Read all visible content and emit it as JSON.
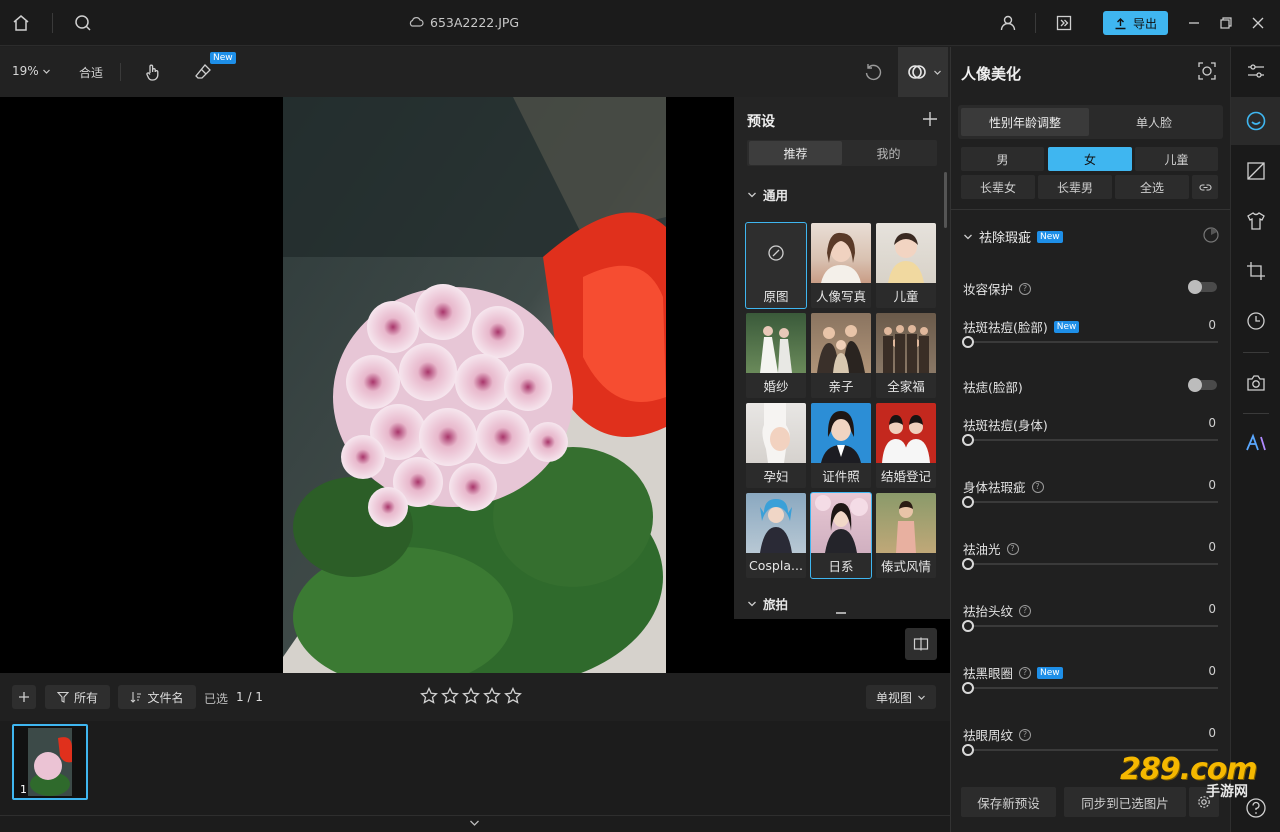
{
  "titlebar": {
    "filename": "653A2222.JPG",
    "export_label": "导出"
  },
  "toolbar": {
    "zoom": "19%",
    "fit_label": "合适",
    "new_badge": "New"
  },
  "preset_panel": {
    "title": "预设",
    "tabs": [
      {
        "label": "推荐",
        "active": true
      },
      {
        "label": "我的",
        "active": false
      }
    ],
    "section_general": "通用",
    "section_travel": "旅拍",
    "tiles": [
      {
        "label": "原图"
      },
      {
        "label": "人像写真"
      },
      {
        "label": "儿童"
      },
      {
        "label": "婚纱"
      },
      {
        "label": "亲子"
      },
      {
        "label": "全家福"
      },
      {
        "label": "孕妇"
      },
      {
        "label": "证件照"
      },
      {
        "label": "结婚登记"
      },
      {
        "label": "Cospla..."
      },
      {
        "label": "日系"
      },
      {
        "label": "傣式风情"
      }
    ]
  },
  "bottombar": {
    "filter_all": "所有",
    "sort_label": "文件名",
    "selected_label": "已选",
    "selected_count": "1 / 1",
    "rating_stars": 5,
    "view_mode": "单视图",
    "thumb_index": "1"
  },
  "right_panel": {
    "title": "人像美化",
    "mode_tabs": [
      {
        "label": "性别年龄调整",
        "active": true
      },
      {
        "label": "单人脸",
        "active": false
      }
    ],
    "gender_row1": [
      {
        "label": "男",
        "active": false
      },
      {
        "label": "女",
        "active": true
      },
      {
        "label": "儿童",
        "active": false
      }
    ],
    "gender_row2": [
      {
        "label": "长辈女"
      },
      {
        "label": "长辈男"
      },
      {
        "label": "全选"
      }
    ],
    "section_title": "祛除瑕疵",
    "section_badge": "New",
    "items": [
      {
        "label": "妆容保护",
        "type": "toggle",
        "help": true,
        "new": false
      },
      {
        "label": "祛斑祛痘(脸部)",
        "type": "slider",
        "value": "0",
        "help": false,
        "new": true
      },
      {
        "label": "祛痣(脸部)",
        "type": "toggle",
        "help": false,
        "new": false
      },
      {
        "label": "祛斑祛痘(身体)",
        "type": "slider",
        "value": "0",
        "help": false,
        "new": false
      },
      {
        "label": "身体祛瑕疵",
        "type": "slider",
        "value": "0",
        "help": true,
        "new": false
      },
      {
        "label": "祛油光",
        "type": "slider",
        "value": "0",
        "help": true,
        "new": false
      },
      {
        "label": "祛抬头纹",
        "type": "slider",
        "value": "0",
        "help": true,
        "new": false
      },
      {
        "label": "祛黑眼圈",
        "type": "slider",
        "value": "0",
        "help": true,
        "new": true
      },
      {
        "label": "祛眼周纹",
        "type": "slider",
        "value": "0",
        "help": true,
        "new": false
      }
    ],
    "save_preset": "保存新预设",
    "sync_selected": "同步到已选图片"
  },
  "watermark": {
    "text": "289.com",
    "subtext": "手游网"
  },
  "colors": {
    "accent": "#3fb6f0",
    "badge": "#1e8fe8"
  }
}
